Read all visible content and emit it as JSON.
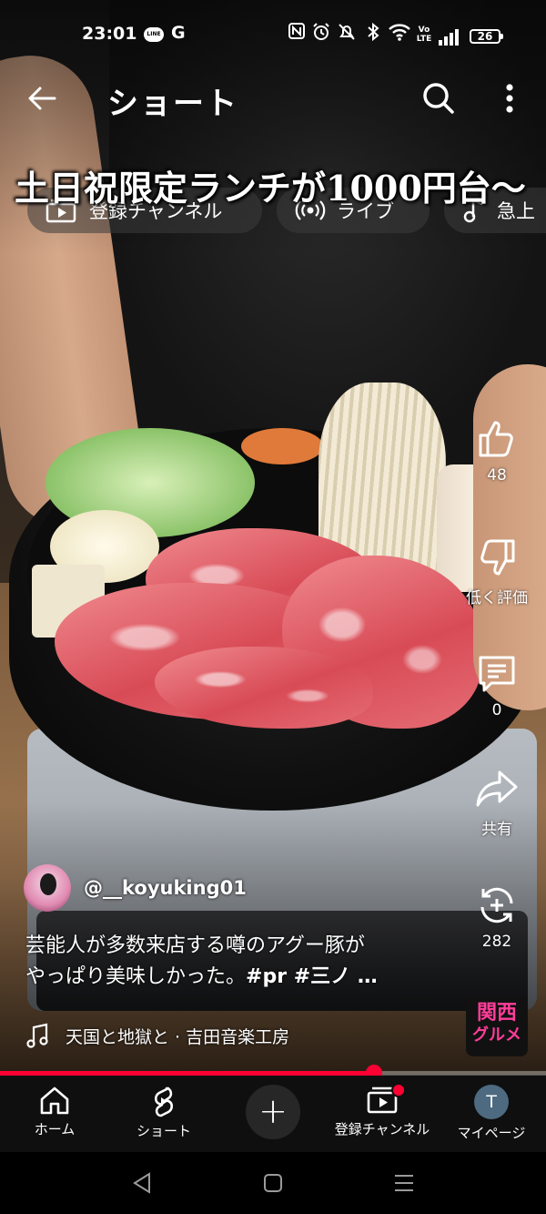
{
  "status_bar": {
    "time": "23:01",
    "line_badge": "LINE",
    "g_letter": "G",
    "battery": "26",
    "volte": "Vo LTE"
  },
  "header": {
    "title": "ショート"
  },
  "chips": [
    {
      "label": "登録チャンネル",
      "icon": "subscriptions-icon"
    },
    {
      "label": "ライブ",
      "icon": "live-icon"
    },
    {
      "label": "急上",
      "icon": "music-note-icon"
    }
  ],
  "video": {
    "overlay_caption": "土日祝限定ランチが1000円台〜",
    "channel_handle": "@__koyuking01",
    "description_line1": "芸能人が多数来店する噂のアグー豚が",
    "description_line2_text": "やっぱり美味しかった。",
    "description_tags": "#pr #三ノ …",
    "music": "天国と地獄と · 吉田音楽工房",
    "logo_line1": "関西",
    "logo_line2": "グルメ",
    "progress_fraction": 0.685
  },
  "actions": {
    "like_count": "48",
    "dislike_label": "低く評価",
    "comment_count": "0",
    "share_label": "共有",
    "remix_count": "282"
  },
  "bottom_nav": {
    "home": "ホーム",
    "shorts": "ショート",
    "create": "+",
    "subscriptions": "登録チャンネル",
    "mypage": "マイページ",
    "avatar_letter": "T"
  },
  "colors": {
    "accent": "#ff0033",
    "nav_bg": "#0f0f0f",
    "logo_pink": "#ff3d9a"
  }
}
